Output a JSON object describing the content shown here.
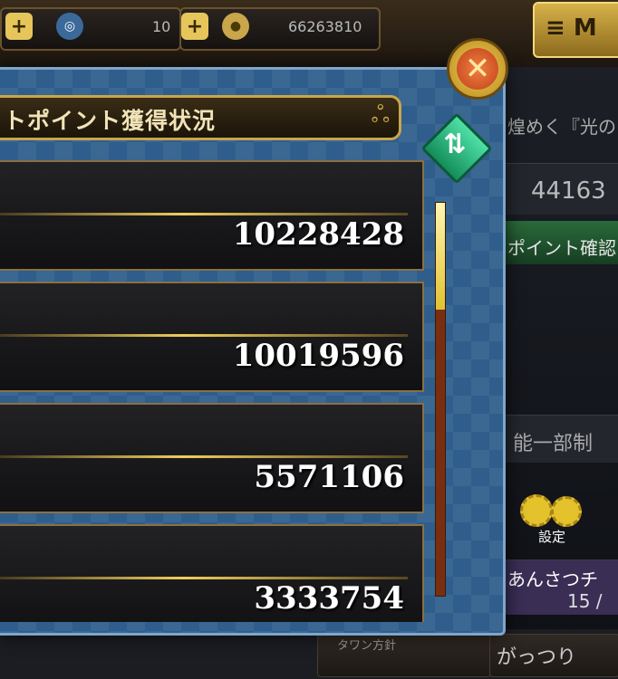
{
  "top_bar": {
    "resource_1_value": "10",
    "resource_2_value": "66263810",
    "menu_label": "≡ M"
  },
  "background": {
    "event_text": "煌めく『光の",
    "score_text": "44163",
    "point_confirm": "ポイント確認",
    "notice_text": "能一部制",
    "settings_label": "設定",
    "anzatsu_label": "あんさつチ",
    "count_text": "15 /",
    "tab_town": "タワン方針",
    "tab_gattsuri": "がっつり"
  },
  "dialog": {
    "title": "トポイント獲得状況",
    "rows": [
      {
        "value": "10228428"
      },
      {
        "value": "10019596"
      },
      {
        "value": "5571106"
      },
      {
        "value": "3333754"
      }
    ],
    "scroll_position": 0
  },
  "colors": {
    "dialog_bg": "#2f5e8c",
    "gold": "#c9a64a",
    "close_button": "#c0401a",
    "refresh_button": "#148d5a"
  },
  "icons": {
    "close": "close-icon",
    "refresh": "refresh-icon",
    "settings": "gear-icon"
  }
}
